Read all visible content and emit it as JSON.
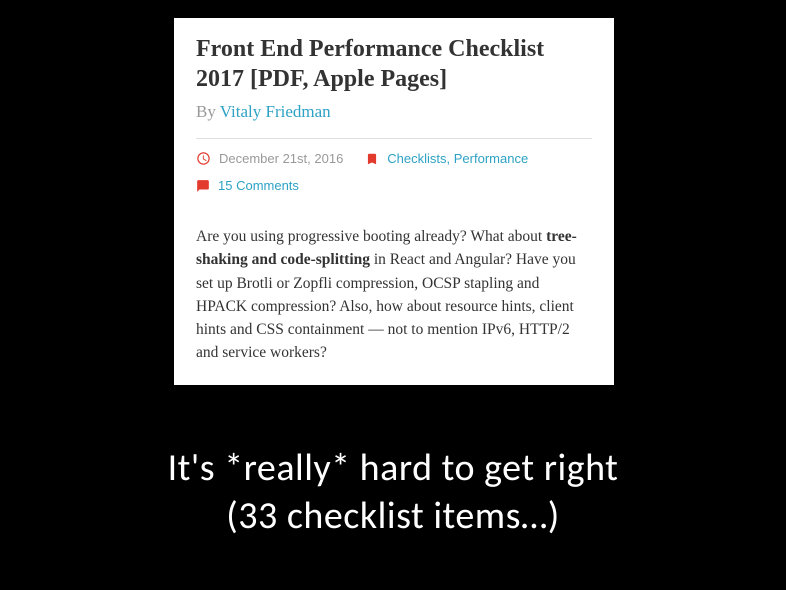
{
  "article": {
    "title": "Front End Performance Checklist 2017 [PDF, Apple Pages]",
    "by_prefix": "By ",
    "author": "Vitaly Friedman",
    "date": "December 21st, 2016",
    "tags": "Checklists, Performance",
    "comments": "15 Comments",
    "body_before": "Are you using progressive booting already? What about ",
    "body_strong": "tree-shaking and code-splitting",
    "body_after": " in React and Angular? Have you set up Brotli or Zopfli compression, OCSP stapling and HPACK compression? Also, how about resource hints, client hints and CSS containment — not to mention IPv6, HTTP/2 and service workers?"
  },
  "caption": {
    "line1": "It's *really* hard to get right",
    "line2": "(33 checklist items…)"
  }
}
